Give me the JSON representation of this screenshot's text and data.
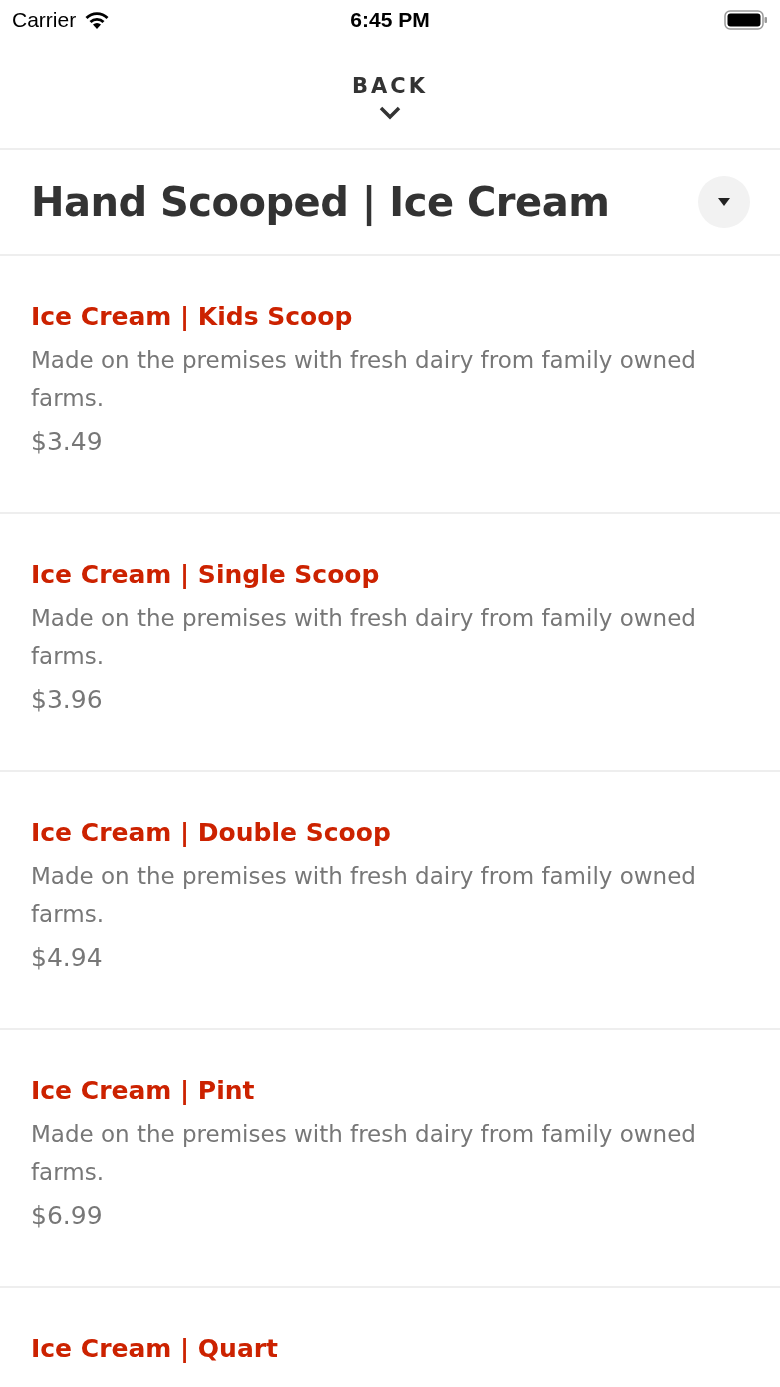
{
  "status_bar": {
    "carrier": "Carrier",
    "time": "6:45 PM"
  },
  "back": {
    "label": "BACK"
  },
  "category": {
    "title": "Hand Scooped | Ice Cream",
    "expanded": true
  },
  "items": [
    {
      "name": "Ice Cream | Kids Scoop",
      "description": "Made on the premises with fresh dairy from family owned farms.",
      "price": "$3.49"
    },
    {
      "name": "Ice Cream | Single Scoop",
      "description": "Made on the premises with fresh dairy from family owned farms.",
      "price": "$3.96"
    },
    {
      "name": "Ice Cream | Double Scoop",
      "description": "Made on the premises with fresh dairy from family owned farms.",
      "price": "$4.94"
    },
    {
      "name": "Ice Cream | Pint",
      "description": "Made on the premises with fresh dairy from family owned farms.",
      "price": "$6.99"
    },
    {
      "name": "Ice Cream | Quart"
    }
  ]
}
